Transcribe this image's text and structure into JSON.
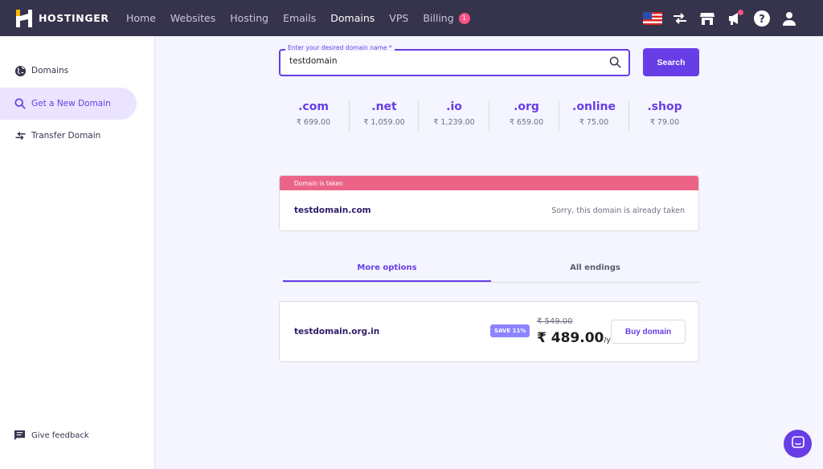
{
  "brand": {
    "name": "HOSTINGER",
    "accent": "#673de6",
    "topbar_bg": "#36344d",
    "danger": "#eb6487"
  },
  "nav": {
    "items": [
      {
        "label": "Home"
      },
      {
        "label": "Websites"
      },
      {
        "label": "Hosting"
      },
      {
        "label": "Emails"
      },
      {
        "label": "Domains"
      },
      {
        "label": "VPS"
      },
      {
        "label": "Billing"
      }
    ],
    "active": "Domains",
    "billing_badge": "1"
  },
  "top_icons": [
    "us-flag-icon",
    "transfer-icon",
    "store-icon",
    "megaphone-icon",
    "help-icon",
    "user-icon"
  ],
  "sidebar": {
    "items": [
      {
        "label": "Domains",
        "icon": "globe-icon"
      },
      {
        "label": "Get a New Domain",
        "icon": "search-icon",
        "active": true
      },
      {
        "label": "Transfer Domain",
        "icon": "transfer-icon"
      }
    ],
    "feedback": "Give feedback"
  },
  "search": {
    "label": "Enter your desired domain name *",
    "value": "testdomain",
    "button": "Search"
  },
  "tlds": [
    {
      "name": ".com",
      "price": "₹ 699.00"
    },
    {
      "name": ".net",
      "price": "₹ 1,059.00"
    },
    {
      "name": ".io",
      "price": "₹ 1,239.00"
    },
    {
      "name": ".org",
      "price": "₹ 659.00"
    },
    {
      "name": ".online",
      "price": "₹ 75.00"
    },
    {
      "name": ".shop",
      "price": "₹ 79.00"
    }
  ],
  "taken": {
    "banner": "Domain is taken",
    "domain": "testdomain.com",
    "message": "Sorry, this domain is already taken"
  },
  "tabs": [
    {
      "label": "More options",
      "active": true
    },
    {
      "label": "All endings"
    }
  ],
  "result": {
    "domain": "testdomain.org.in",
    "save_badge": "SAVE 11%",
    "old_price": "₹ 549.00",
    "new_price": "₹ 489.00",
    "period": "/yr",
    "button": "Buy domain"
  }
}
